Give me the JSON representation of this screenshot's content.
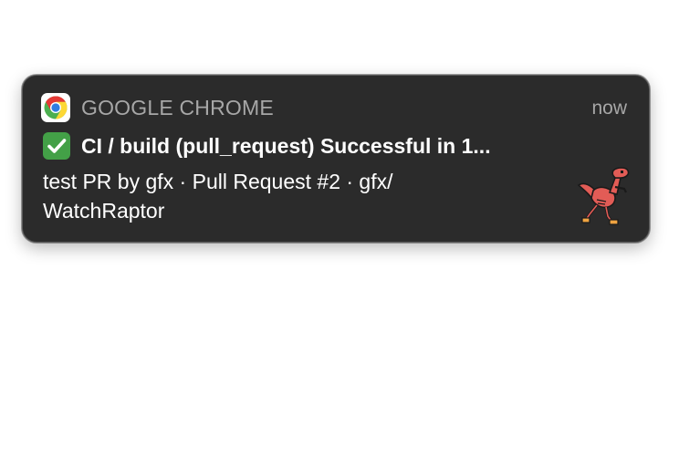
{
  "notification": {
    "app_name": "GOOGLE CHROME",
    "time": "now",
    "app_icon": "chrome-icon",
    "status_emoji": "check-mark-button-icon",
    "title": "CI / build (pull_request) Successful in 1...",
    "body": "test PR by gfx · Pull Request #2 · gfx/ WatchRaptor",
    "thumbnail_icon": "raptor-icon",
    "colors": {
      "background": "#2b2b2b",
      "secondary_text": "#a7a7a7",
      "primary_text": "#ffffff",
      "check_green": "#43a047",
      "raptor_red": "#e25c56"
    }
  }
}
